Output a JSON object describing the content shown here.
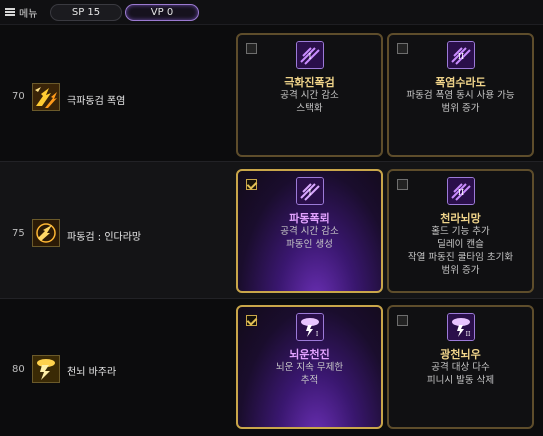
{
  "topbar": {
    "menu_label": "메뉴",
    "sp_label": "SP 15",
    "vp_label": "VP 0"
  },
  "colors": {
    "gold_border": "#5e4d2b",
    "gold_selected": "#c9a64a",
    "purple_glow": "#6a2fb4",
    "title_gold": "#f0d48a",
    "title_purple": "#e2a2ff"
  },
  "rows": [
    {
      "level": "70",
      "skill_name": "극파동검 폭염",
      "icon": "flame-burst-icon",
      "options": [
        {
          "title": "극화진폭검",
          "desc": [
            "공격 시간 감소",
            "스택화"
          ],
          "selected": false,
          "roman": "I",
          "icon": "purple-sword-icon"
        },
        {
          "title": "폭염수라도",
          "desc": [
            "파동검 폭염 동시 사용 가능",
            "범위 증가"
          ],
          "selected": false,
          "roman": "II",
          "icon": "purple-sword-icon"
        }
      ]
    },
    {
      "level": "75",
      "skill_name": "파동검 : 인다라망",
      "icon": "lightning-net-icon",
      "options": [
        {
          "title": "파동폭뢰",
          "desc": [
            "공격 시간 감소",
            "파동인 생성"
          ],
          "selected": true,
          "roman": "I",
          "icon": "purple-sword-icon"
        },
        {
          "title": "천라뇌망",
          "desc": [
            "홀드 기능 추가",
            "딜레이 캔슬",
            "작열 파동진 쿨타임 초기화",
            "범위 증가"
          ],
          "selected": false,
          "roman": "II",
          "icon": "purple-sword-icon"
        }
      ]
    },
    {
      "level": "80",
      "skill_name": "천뇌 바주라",
      "icon": "thunder-strike-icon",
      "options": [
        {
          "title": "뇌운천진",
          "desc": [
            "뇌운 지속 무제한",
            "추적"
          ],
          "selected": true,
          "roman": "I",
          "icon": "thunder-cloud-icon"
        },
        {
          "title": "광천뇌우",
          "desc": [
            "공격 대상 다수",
            "피니시 발동 삭제"
          ],
          "selected": false,
          "roman": "II",
          "icon": "thunder-cloud-icon"
        }
      ]
    }
  ]
}
